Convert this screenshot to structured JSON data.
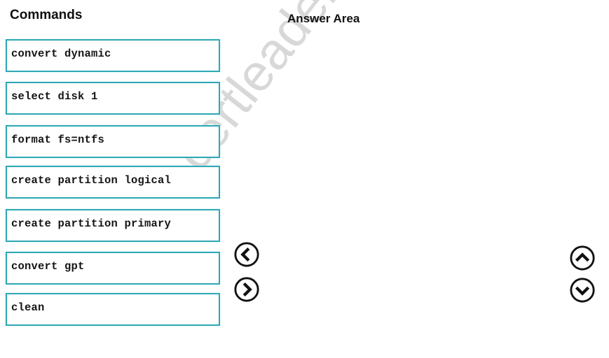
{
  "commands_panel": {
    "title": "Commands",
    "items": [
      {
        "label": "convert dynamic"
      },
      {
        "label": "select disk 1"
      },
      {
        "label": "format fs=ntfs"
      },
      {
        "label": "create partition logical"
      },
      {
        "label": "create partition primary"
      },
      {
        "label": "convert gpt"
      },
      {
        "label": "clean"
      }
    ]
  },
  "answer_panel": {
    "title": "Answer Area",
    "items": []
  },
  "controls": {
    "move_left": {
      "icon": "chevron-left-circle-icon"
    },
    "move_right": {
      "icon": "chevron-right-circle-icon"
    },
    "move_up": {
      "icon": "chevron-up-circle-icon"
    },
    "move_down": {
      "icon": "chevron-down-circle-icon"
    }
  },
  "watermark": {
    "text": "certleader.com"
  },
  "colors": {
    "box_border": "#2fa7b5",
    "watermark": "#d4d4d4",
    "text": "#151515"
  }
}
